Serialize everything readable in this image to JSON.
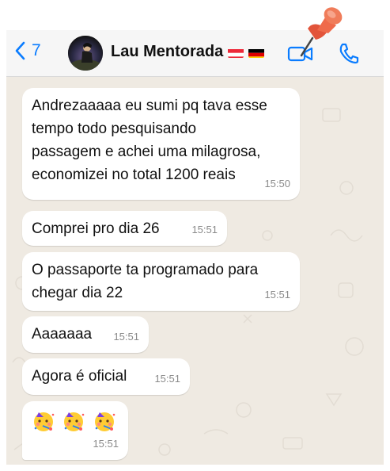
{
  "header": {
    "back_count": "7",
    "contact_name": "Lau Mentorada",
    "flags": [
      "austria-flag",
      "germany-flag"
    ],
    "accent_color": "#0a7cff"
  },
  "messages": [
    {
      "text": "Andrezaaaaa eu sumi pq tava esse\ntempo todo pesquisando\npassagem e achei uma milagrosa,\neconomizei no total 1200 reais",
      "time": "15:50"
    },
    {
      "text": "Comprei pro dia 26",
      "time": "15:51"
    },
    {
      "text": "O passaporte ta programado para\nchegar dia 22",
      "time": "15:51"
    },
    {
      "text": "Aaaaaaa",
      "time": "15:51"
    },
    {
      "text": "Agora é oficial",
      "time": "15:51"
    },
    {
      "emojis": [
        "partying-face-emoji",
        "partying-face-emoji",
        "partying-face-emoji"
      ],
      "time": "15:51"
    }
  ],
  "colors": {
    "chat_background": "#efeae2",
    "bubble_background": "#ffffff",
    "timestamp": "#8a8a8a"
  }
}
